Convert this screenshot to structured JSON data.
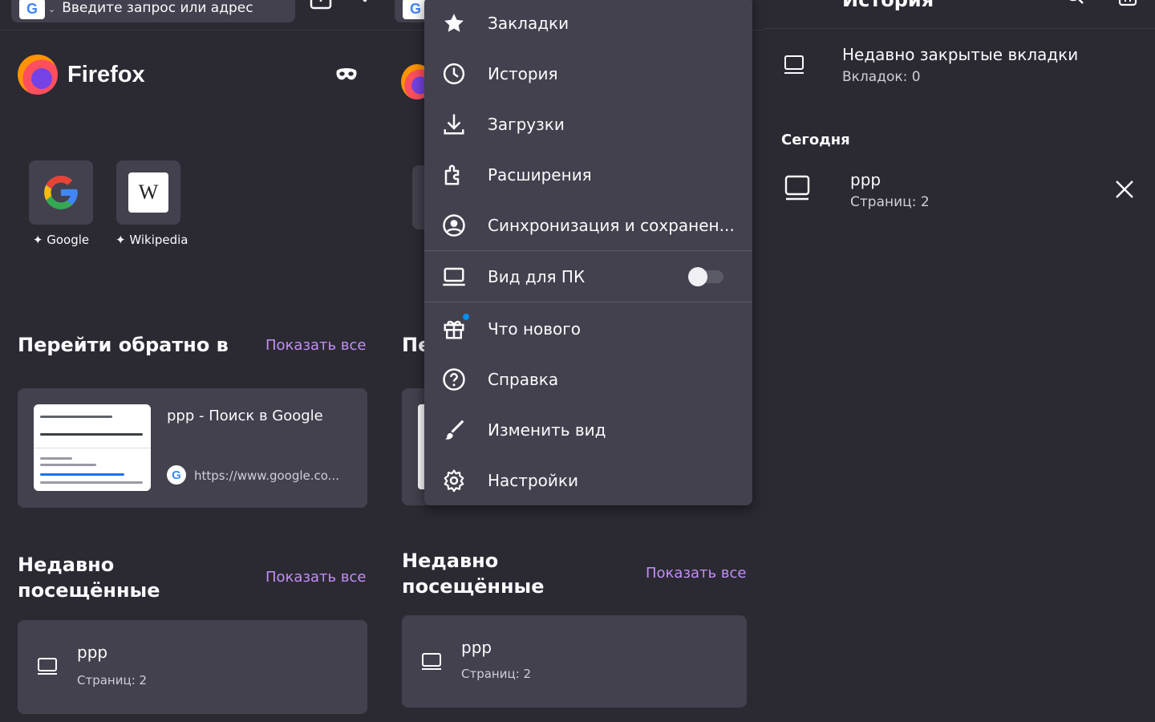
{
  "panel1": {
    "url_placeholder": "Введите запрос или адрес",
    "brand": "Firefox",
    "shortcuts": [
      {
        "label": "Google",
        "icon": "google-icon"
      },
      {
        "label": "Wikipedia",
        "icon": "wikipedia-icon"
      }
    ],
    "jump_back": {
      "title": "Перейти обратно в",
      "show_all": "Показать все",
      "card_title": "ррр - Поиск в Google",
      "card_url": "https://www.google.co..."
    },
    "recent": {
      "title_line1": "Недавно",
      "title_line2": "посещённые",
      "show_all": "Показать все",
      "item_name": "ррр",
      "item_sub": "Страниц: 2"
    }
  },
  "panel2": {
    "partial_title": "Пе",
    "recent": {
      "title_line1": "Недавно",
      "title_line2": "посещённые",
      "show_all": "Показать все",
      "item_name": "ррр",
      "item_sub": "Страниц: 2"
    }
  },
  "menu": {
    "items": [
      {
        "label": "Закладки",
        "icon": "star-icon"
      },
      {
        "label": "История",
        "icon": "clock-icon"
      },
      {
        "label": "Загрузки",
        "icon": "download-icon"
      },
      {
        "label": "Расширения",
        "icon": "puzzle-icon"
      },
      {
        "label": "Синхронизация и сохранен...",
        "icon": "account-icon"
      },
      {
        "label": "Вид для ПК",
        "icon": "laptop-icon",
        "toggle": false
      },
      {
        "label": "Что нового",
        "icon": "gift-icon"
      },
      {
        "label": "Справка",
        "icon": "help-icon"
      },
      {
        "label": "Изменить вид",
        "icon": "brush-icon"
      },
      {
        "label": "Настройки",
        "icon": "gear-icon"
      }
    ]
  },
  "panel3": {
    "title": "История",
    "recently_closed": "Недавно закрытые вкладки",
    "recently_closed_count": "Вкладок: 0",
    "today": "Сегодня",
    "item_name": "ррр",
    "item_sub": "Страниц: 2"
  },
  "colors": {
    "accent": "#c38ef8",
    "bg": "#2b2a33",
    "surface": "#42414d"
  }
}
